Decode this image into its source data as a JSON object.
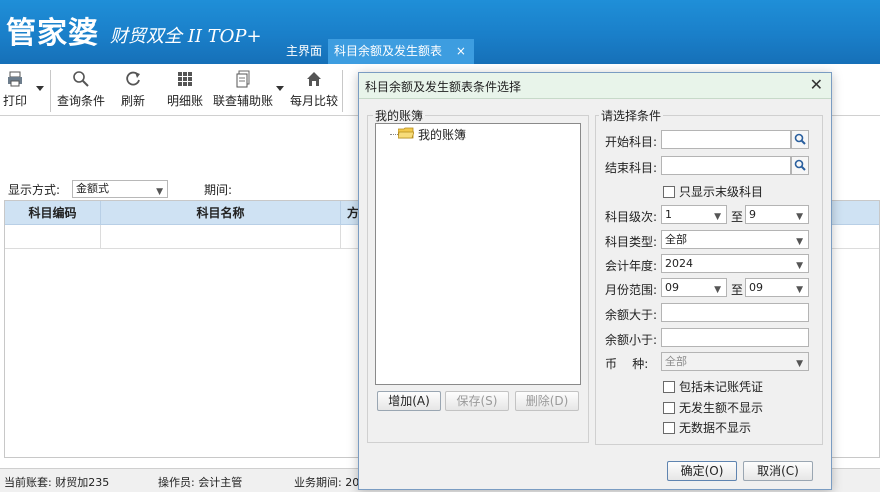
{
  "app": {
    "logo_main": "管家婆",
    "logo_sub": "财贸双全 II TOP+",
    "tabs": [
      {
        "label": "主界面"
      },
      {
        "label": "科目余额及发生额表",
        "close": "×"
      }
    ]
  },
  "toolbar": {
    "print": "打印",
    "query": "查询条件",
    "refresh": "刷新",
    "detail": "明细账",
    "aux": "联查辅助账",
    "monthly": "每月比较"
  },
  "filter": {
    "display_label": "显示方式:",
    "display_value": "金额式",
    "period_label": "期间:"
  },
  "grid": {
    "headers": [
      "科目编码",
      "科目名称",
      "方"
    ]
  },
  "status": {
    "account_set": "当前账套: 财贸加235",
    "operator": "操作员: 会计主管",
    "period": "业务期间: 20"
  },
  "dialog": {
    "title": "科目余额及发生额表条件选择",
    "close": "✕",
    "books_group": "我的账簿",
    "tree_root": "我的账簿",
    "add_btn": "增加(A)",
    "save_btn": "保存(S)",
    "delete_btn": "删除(D)",
    "cond_group": "请选择条件",
    "start_subject_label": "开始科目:",
    "start_subject_value": "",
    "end_subject_label": "结束科目:",
    "end_subject_value": "",
    "only_leaf_label": "只显示末级科目",
    "level_label": "科目级次:",
    "level_from": "1",
    "to_label": "至",
    "level_to": "9",
    "type_label": "科目类型:",
    "type_value": "全部",
    "year_label": "会计年度:",
    "year_value": "2024",
    "month_label": "月份范围:",
    "month_from": "09",
    "month_to": "09",
    "balance_gt_label": "余额大于:",
    "balance_gt_value": "",
    "balance_lt_label": "余额小于:",
    "balance_lt_value": "",
    "currency_label": "币    种:",
    "currency_value": "全部",
    "include_unposted": "包括未记账凭证",
    "hide_no_activity": "无发生额不显示",
    "hide_no_data": "无数据不显示",
    "ok_btn": "确定(O)",
    "cancel_btn": "取消(C)"
  }
}
